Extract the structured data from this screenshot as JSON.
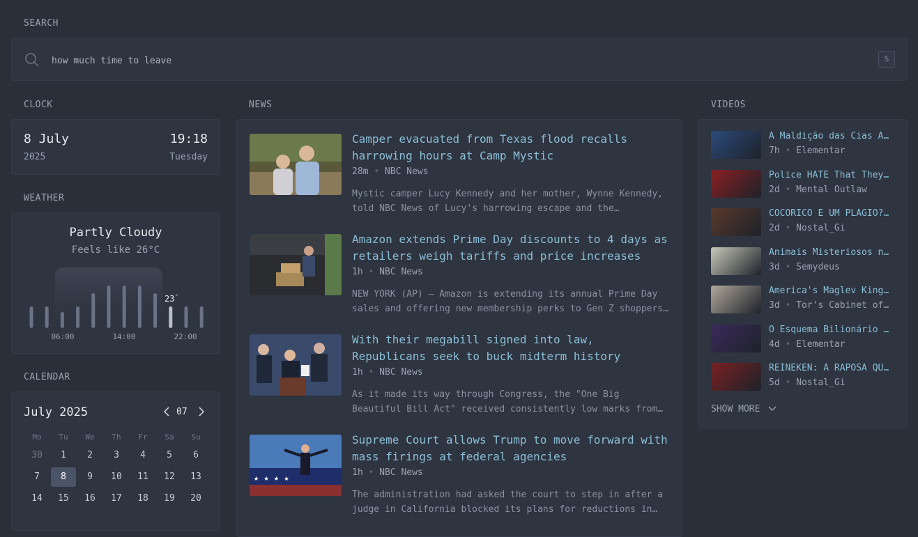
{
  "search": {
    "title": "SEARCH",
    "value": "how much time to leave",
    "shortcut": "S",
    "icon": "search-icon"
  },
  "clock": {
    "title": "CLOCK",
    "date": "8 July",
    "year": "2025",
    "time": "19:18",
    "weekday": "Tuesday"
  },
  "weather": {
    "title": "WEATHER",
    "condition": "Partly Cloudy",
    "feels_like": "Feels like 26°C",
    "current_temp": "23",
    "degree": "°",
    "time_labels": [
      "06:00",
      "14:00",
      "22:00"
    ],
    "bar_levels": [
      0.35,
      0.35,
      0.25,
      0.35,
      0.55,
      0.68,
      0.68,
      0.68,
      0.55,
      0.35,
      0.35,
      0.35
    ]
  },
  "calendar": {
    "title": "CALENDAR",
    "month_label": "July 2025",
    "month_number": "07",
    "weekdays": [
      "Mo",
      "Tu",
      "We",
      "Th",
      "Fr",
      "Sa",
      "Su"
    ],
    "days": [
      "30",
      "1",
      "2",
      "3",
      "4",
      "5",
      "6",
      "7",
      "8",
      "9",
      "10",
      "11",
      "12",
      "13",
      "14",
      "15",
      "16",
      "17",
      "18",
      "19",
      "20"
    ],
    "muted_days": [
      "30"
    ],
    "today": "8"
  },
  "news": {
    "title": "NEWS",
    "items": [
      {
        "title": "Camper evacuated from Texas flood recalls harrowing hours at Camp Mystic",
        "age": "28m",
        "source": "NBC News",
        "description": "Mystic camper Lucy Kennedy and her mother, Wynne Kennedy, told NBC News of Lucy's harrowing escape and the…"
      },
      {
        "title": "Amazon extends Prime Day discounts to 4 days as retailers weigh tariffs and price increases",
        "age": "1h",
        "source": "NBC News",
        "description": "NEW YORK (AP) — Amazon is extending its annual Prime Day sales and offering new membership perks to Gen Z shoppers…"
      },
      {
        "title": "With their megabill signed into law, Republicans seek to buck midterm history",
        "age": "1h",
        "source": "NBC News",
        "description": "As it made its way through Congress, the \"One Big Beautiful Bill Act\" received consistently low marks from…"
      },
      {
        "title": "Supreme Court allows Trump to move forward with mass firings at federal agencies",
        "age": "1h",
        "source": "NBC News",
        "description": "The administration had asked the court to step in after a judge in California blocked its plans for reductions in…"
      }
    ]
  },
  "videos": {
    "title": "VIDEOS",
    "show_more": "SHOW MORE",
    "items": [
      {
        "title": "A Maldição das Cias Aéreas",
        "age": "7h",
        "channel": "Elementar",
        "thumb_color": "#2b4a7a"
      },
      {
        "title": "Police HATE That They Can't Stop This",
        "age": "2d",
        "channel": "Mental Outlaw",
        "thumb_color": "#8a1f22"
      },
      {
        "title": "COCORICÓ É UM PLÁGIO? A história",
        "age": "2d",
        "channel": "Nostal_Gi",
        "thumb_color": "#5a3a2a"
      },
      {
        "title": "Animais Misteriosos na História",
        "age": "3d",
        "channel": "Semydeus",
        "thumb_color": "#c8c8b8"
      },
      {
        "title": "America's Maglev King Never Got Built",
        "age": "3d",
        "channel": "Tor's Cabinet of Curiosities",
        "thumb_color": "#b0a89a"
      },
      {
        "title": "O Esquema Bilionário dos Ingressos",
        "age": "4d",
        "channel": "Elementar",
        "thumb_color": "#3a2a5a"
      },
      {
        "title": "REINEKEN: A RAPOSA QUE MARCOU",
        "age": "5d",
        "channel": "Nostal_Gi",
        "thumb_color": "#7a2020"
      }
    ]
  }
}
